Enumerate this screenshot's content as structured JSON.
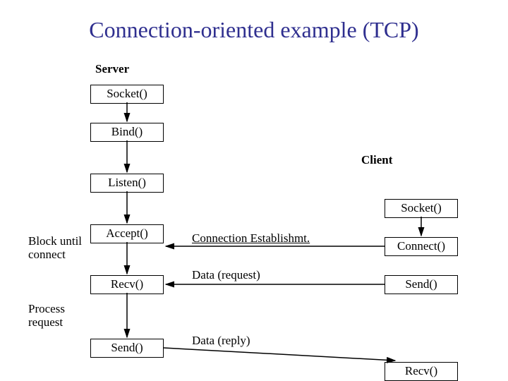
{
  "title": "Connection-oriented example (TCP)",
  "server_header": "Server",
  "client_header": "Client",
  "server_boxes": {
    "socket": "Socket()",
    "bind": "Bind()",
    "listen": "Listen()",
    "accept": "Accept()",
    "recv": "Recv()",
    "send": "Send()"
  },
  "client_boxes": {
    "socket": "Socket()",
    "connect": "Connect()",
    "send": "Send()",
    "recv": "Recv()"
  },
  "annotations": {
    "block_until_connect_l1": "Block until",
    "block_until_connect_l2": "connect",
    "process_request_l1": "Process",
    "process_request_l2": "request",
    "conn_est": "Connection Establishmt.",
    "data_req": "Data (request)",
    "data_reply": "Data (reply)"
  }
}
